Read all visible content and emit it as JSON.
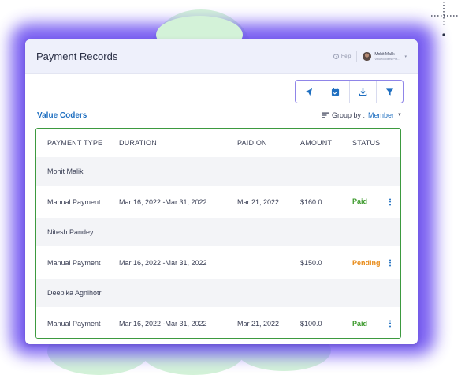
{
  "header": {
    "title": "Payment Records",
    "help_label": "Help",
    "user_name": "Mohit Malik",
    "user_company": "Valuecoders Pvt..."
  },
  "toolbar": {
    "icons": [
      "send-icon",
      "calendar-check-icon",
      "download-icon",
      "filter-icon"
    ]
  },
  "section": {
    "title": "Value Coders",
    "group_by_label": "Group by :",
    "group_by_value": "Member"
  },
  "table": {
    "headers": {
      "payment_type": "PAYMENT TYPE",
      "duration": "DURATION",
      "paid_on": "PAID ON",
      "amount": "AMOUNT",
      "status": "STATUS"
    },
    "groups": [
      {
        "member": "Mohit Malik",
        "payment_type": "Manual Payment",
        "duration": "Mar 16, 2022 -Mar 31, 2022",
        "paid_on": "Mar 21, 2022",
        "amount": "$160.0",
        "status": "Paid"
      },
      {
        "member": "Nitesh Pandey",
        "payment_type": "Manual Payment",
        "duration": "Mar 16, 2022 -Mar 31, 2022",
        "paid_on": "",
        "amount": "$150.0",
        "status": "Pending"
      },
      {
        "member": "Deepika Agnihotri",
        "payment_type": "Manual Payment",
        "duration": "Mar 16, 2022 -Mar 31, 2022",
        "paid_on": "Mar 21, 2022",
        "amount": "$100.0",
        "status": "Paid"
      }
    ]
  },
  "colors": {
    "accent": "#1f6fc0",
    "frame": "#6b4ef0",
    "paid": "#3c9a2c",
    "pending": "#e88a16",
    "table_border": "#3d9a3f"
  }
}
